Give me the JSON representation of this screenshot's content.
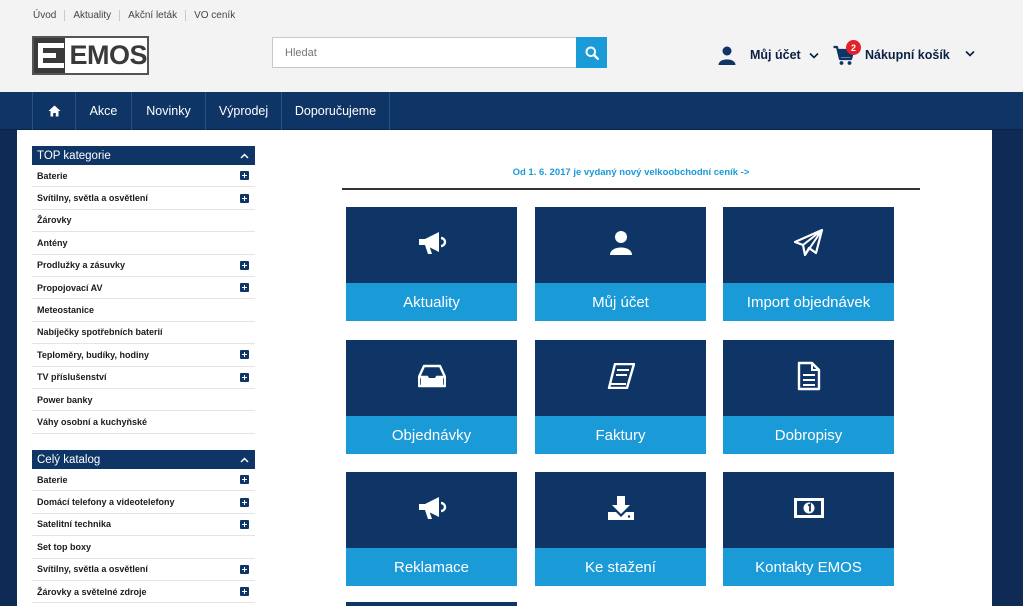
{
  "top_links": [
    "Úvod",
    "Aktuality",
    "Akční leták",
    "VO ceník"
  ],
  "logo": {
    "text": "EMOS"
  },
  "search": {
    "placeholder": "Hledat"
  },
  "account": {
    "label": "Můj účet"
  },
  "cart": {
    "label": "Nákupní košík",
    "count": "2"
  },
  "nav": {
    "items": [
      "Akce",
      "Novinky",
      "Výprodej",
      "Doporučujeme"
    ]
  },
  "top_categories": {
    "title": "TOP kategorie",
    "items": [
      {
        "label": "Baterie",
        "expandable": true
      },
      {
        "label": "Svítilny, světla a osvětlení",
        "expandable": true
      },
      {
        "label": "Žárovky",
        "expandable": false
      },
      {
        "label": "Antény",
        "expandable": false
      },
      {
        "label": "Prodlužky a zásuvky",
        "expandable": true
      },
      {
        "label": "Propojovací AV",
        "expandable": true
      },
      {
        "label": "Meteostanice",
        "expandable": false
      },
      {
        "label": "Nabíječky spotřebních baterií",
        "expandable": false
      },
      {
        "label": "Teploměry, budíky, hodiny",
        "expandable": true
      },
      {
        "label": "TV příslušenství",
        "expandable": true
      },
      {
        "label": "Power banky",
        "expandable": false
      },
      {
        "label": "Váhy osobní a kuchyňské",
        "expandable": false
      }
    ]
  },
  "catalog": {
    "title": "Celý katalog",
    "items": [
      {
        "label": "Baterie",
        "expandable": true
      },
      {
        "label": "Domácí telefony a videotelefony",
        "expandable": true
      },
      {
        "label": "Satelitní technika",
        "expandable": true
      },
      {
        "label": "Set top boxy",
        "expandable": false
      },
      {
        "label": "Svítilny, světla a osvětlení",
        "expandable": true
      },
      {
        "label": "Žárovky a světelné zdroje",
        "expandable": true
      }
    ]
  },
  "notice": "Od 1. 6. 2017 je vydaný nový velkoobchodní ceník ->",
  "tiles": [
    {
      "label": "Aktuality",
      "icon": "megaphone-icon"
    },
    {
      "label": "Můj účet",
      "icon": "user-icon"
    },
    {
      "label": "Import objednávek",
      "icon": "paper-plane-icon"
    },
    {
      "label": "Objednávky",
      "icon": "inbox-icon"
    },
    {
      "label": "Faktury",
      "icon": "book-icon"
    },
    {
      "label": "Dobropisy",
      "icon": "document-icon"
    },
    {
      "label": "Reklamace",
      "icon": "megaphone-icon"
    },
    {
      "label": "Ke stažení",
      "icon": "download-icon"
    },
    {
      "label": "Kontakty EMOS",
      "icon": "money-icon"
    }
  ],
  "colors": {
    "navy": "#0f3566",
    "accent": "#1a9ad6",
    "badge": "#e3212b"
  }
}
